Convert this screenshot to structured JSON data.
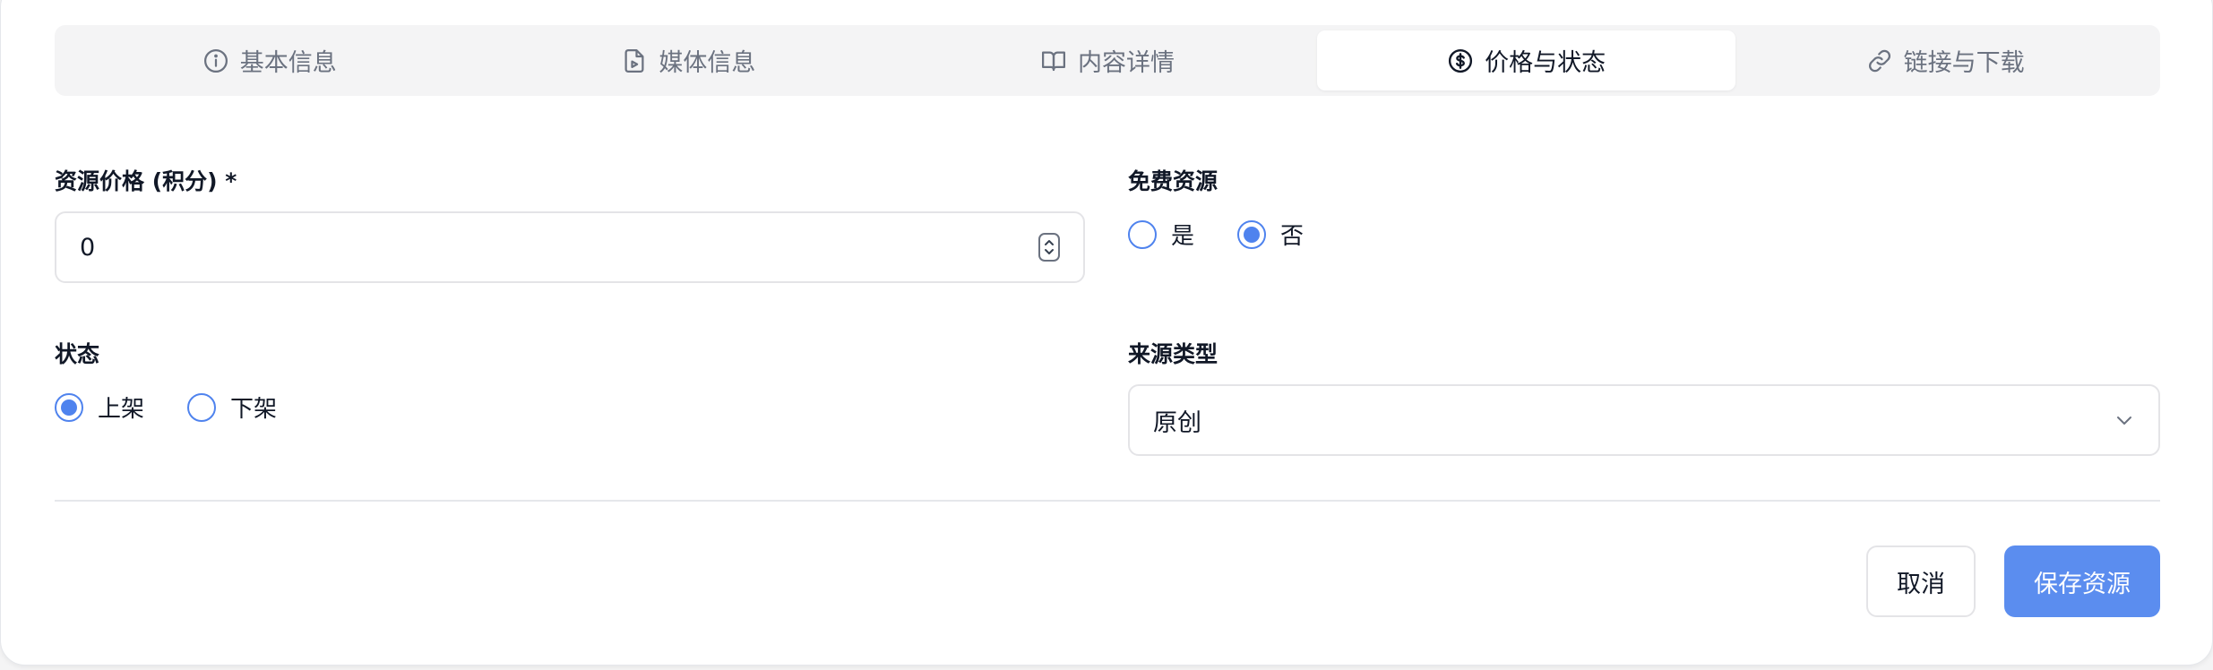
{
  "tabs": [
    {
      "label": "基本信息",
      "icon": "info-icon",
      "active": false
    },
    {
      "label": "媒体信息",
      "icon": "file-video-icon",
      "active": false
    },
    {
      "label": "内容详情",
      "icon": "book-open-icon",
      "active": false
    },
    {
      "label": "价格与状态",
      "icon": "dollar-circle-icon",
      "active": true
    },
    {
      "label": "链接与下载",
      "icon": "link-icon",
      "active": false
    }
  ],
  "price": {
    "label": "资源价格 (积分) *",
    "value": "0"
  },
  "free": {
    "label": "免费资源",
    "options": [
      "是",
      "否"
    ],
    "selected": "否"
  },
  "status": {
    "label": "状态",
    "options": [
      "上架",
      "下架"
    ],
    "selected": "上架"
  },
  "source": {
    "label": "来源类型",
    "value": "原创"
  },
  "actions": {
    "cancel_label": "取消",
    "save_label": "保存资源"
  },
  "colors": {
    "accent": "#4f83ee",
    "save_button": "#5b8def",
    "tab_bar": "#f4f4f5"
  }
}
